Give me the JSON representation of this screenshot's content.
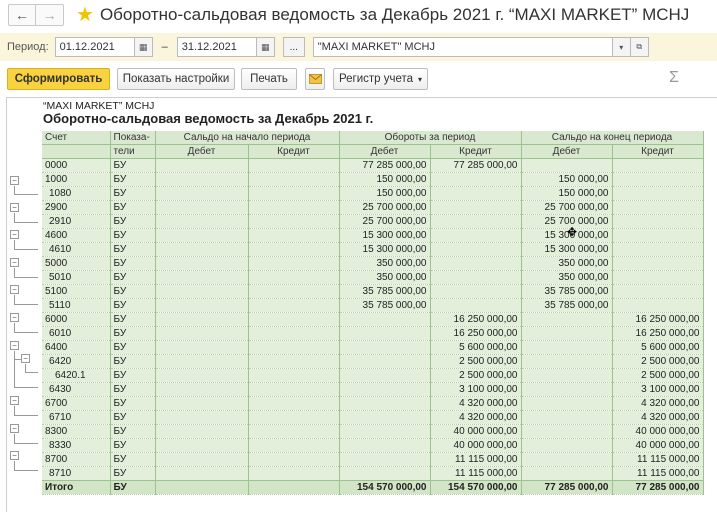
{
  "window": {
    "back_label": "←",
    "forward_label": "→",
    "title": "Оборотно-сальдовая ведомость за Декабрь 2021 г. “MAXI MARKET” MCHJ"
  },
  "period": {
    "label": "Период:",
    "from": "01.12.2021",
    "dash": "–",
    "to": "31.12.2021",
    "ellipsis": "...",
    "org": "\"MAXI MARKET\" MCHJ"
  },
  "toolbar": {
    "generate": "Сформировать",
    "show_settings": "Показать настройки",
    "print": "Печать",
    "register": "Регистр учета",
    "sigma": "Σ"
  },
  "report": {
    "org": "“MAXI MARKET” MCHJ",
    "title": "Оборотно-сальдовая ведомость за Декабрь 2021 г.",
    "headers": {
      "account": "Счет",
      "indicator_1": "Показа-",
      "indicator_2": "тели",
      "opening": "Сальдо на начало периода",
      "turnover": "Обороты за период",
      "closing": "Сальдо на конец периода",
      "debit": "Дебет",
      "credit": "Кредит"
    },
    "rows": [
      {
        "acc": "0000",
        "ind": "БУ",
        "od": "",
        "oc": "",
        "td": "77 285 000,00",
        "tc": "77 285 000,00",
        "cd": "",
        "cc": ""
      },
      {
        "acc": "1000",
        "ind": "БУ",
        "od": "",
        "oc": "",
        "td": "150 000,00",
        "tc": "",
        "cd": "150 000,00",
        "cc": ""
      },
      {
        "acc": "1080",
        "ind": "БУ",
        "od": "",
        "oc": "",
        "td": "150 000,00",
        "tc": "",
        "cd": "150 000,00",
        "cc": ""
      },
      {
        "acc": "2900",
        "ind": "БУ",
        "od": "",
        "oc": "",
        "td": "25 700 000,00",
        "tc": "",
        "cd": "25 700 000,00",
        "cc": ""
      },
      {
        "acc": "2910",
        "ind": "БУ",
        "od": "",
        "oc": "",
        "td": "25 700 000,00",
        "tc": "",
        "cd": "25 700 000,00",
        "cc": ""
      },
      {
        "acc": "4600",
        "ind": "БУ",
        "od": "",
        "oc": "",
        "td": "15 300 000,00",
        "tc": "",
        "cd": "15 300 000,00",
        "cc": ""
      },
      {
        "acc": "4610",
        "ind": "БУ",
        "od": "",
        "oc": "",
        "td": "15 300 000,00",
        "tc": "",
        "cd": "15 300 000,00",
        "cc": ""
      },
      {
        "acc": "5000",
        "ind": "БУ",
        "od": "",
        "oc": "",
        "td": "350 000,00",
        "tc": "",
        "cd": "350 000,00",
        "cc": ""
      },
      {
        "acc": "5010",
        "ind": "БУ",
        "od": "",
        "oc": "",
        "td": "350 000,00",
        "tc": "",
        "cd": "350 000,00",
        "cc": ""
      },
      {
        "acc": "5100",
        "ind": "БУ",
        "od": "",
        "oc": "",
        "td": "35 785 000,00",
        "tc": "",
        "cd": "35 785 000,00",
        "cc": ""
      },
      {
        "acc": "5110",
        "ind": "БУ",
        "od": "",
        "oc": "",
        "td": "35 785 000,00",
        "tc": "",
        "cd": "35 785 000,00",
        "cc": ""
      },
      {
        "acc": "6000",
        "ind": "БУ",
        "od": "",
        "oc": "",
        "td": "",
        "tc": "16 250 000,00",
        "cd": "",
        "cc": "16 250 000,00"
      },
      {
        "acc": "6010",
        "ind": "БУ",
        "od": "",
        "oc": "",
        "td": "",
        "tc": "16 250 000,00",
        "cd": "",
        "cc": "16 250 000,00"
      },
      {
        "acc": "6400",
        "ind": "БУ",
        "od": "",
        "oc": "",
        "td": "",
        "tc": "5 600 000,00",
        "cd": "",
        "cc": "5 600 000,00"
      },
      {
        "acc": "6420",
        "ind": "БУ",
        "od": "",
        "oc": "",
        "td": "",
        "tc": "2 500 000,00",
        "cd": "",
        "cc": "2 500 000,00"
      },
      {
        "acc": "6420.1",
        "ind": "БУ",
        "od": "",
        "oc": "",
        "td": "",
        "tc": "2 500 000,00",
        "cd": "",
        "cc": "2 500 000,00"
      },
      {
        "acc": "6430",
        "ind": "БУ",
        "od": "",
        "oc": "",
        "td": "",
        "tc": "3 100 000,00",
        "cd": "",
        "cc": "3 100 000,00"
      },
      {
        "acc": "6700",
        "ind": "БУ",
        "od": "",
        "oc": "",
        "td": "",
        "tc": "4 320 000,00",
        "cd": "",
        "cc": "4 320 000,00"
      },
      {
        "acc": "6710",
        "ind": "БУ",
        "od": "",
        "oc": "",
        "td": "",
        "tc": "4 320 000,00",
        "cd": "",
        "cc": "4 320 000,00"
      },
      {
        "acc": "8300",
        "ind": "БУ",
        "od": "",
        "oc": "",
        "td": "",
        "tc": "40 000 000,00",
        "cd": "",
        "cc": "40 000 000,00"
      },
      {
        "acc": "8330",
        "ind": "БУ",
        "od": "",
        "oc": "",
        "td": "",
        "tc": "40 000 000,00",
        "cd": "",
        "cc": "40 000 000,00"
      },
      {
        "acc": "8700",
        "ind": "БУ",
        "od": "",
        "oc": "",
        "td": "",
        "tc": "11 115 000,00",
        "cd": "",
        "cc": "11 115 000,00"
      },
      {
        "acc": "8710",
        "ind": "БУ",
        "od": "",
        "oc": "",
        "td": "",
        "tc": "11 115 000,00",
        "cd": "",
        "cc": "11 115 000,00"
      }
    ],
    "total": {
      "acc": "Итого",
      "ind": "БУ",
      "od": "",
      "oc": "",
      "td": "154 570 000,00",
      "tc": "154 570 000,00",
      "cd": "77 285 000,00",
      "cc": "77 285 000,00"
    }
  }
}
